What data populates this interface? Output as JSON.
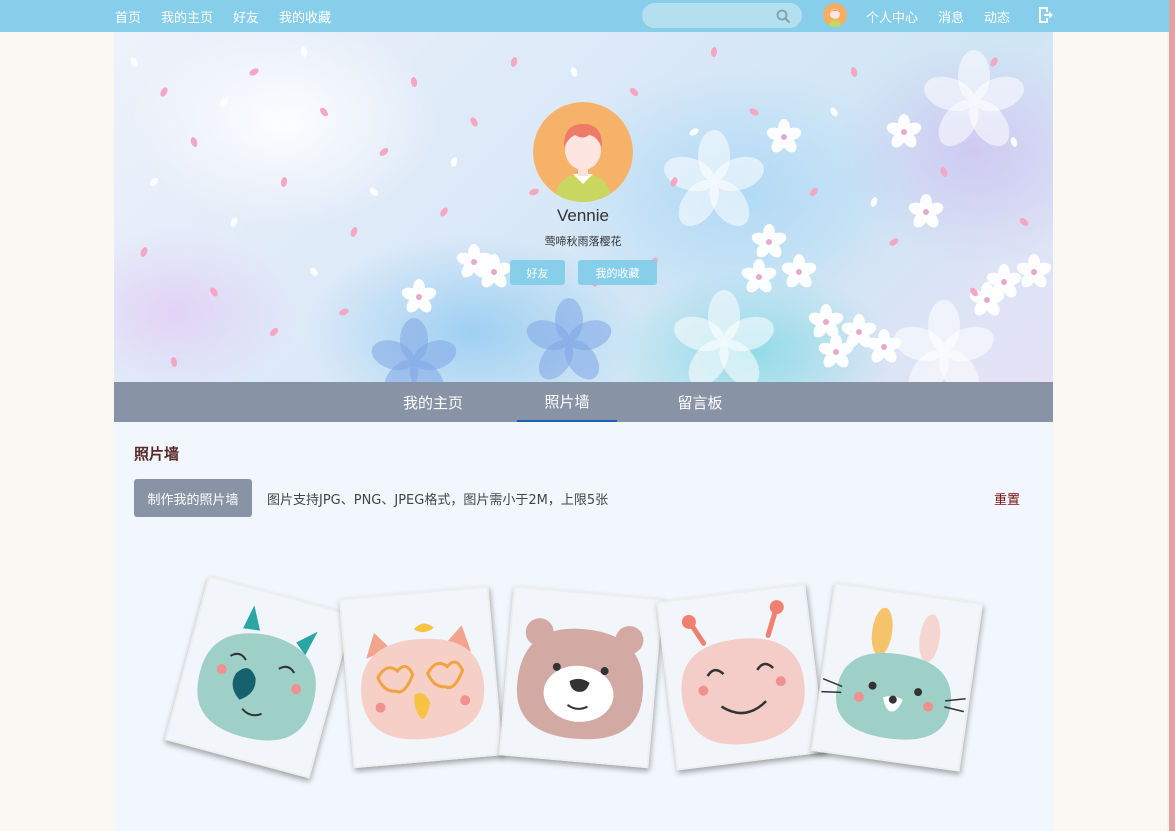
{
  "topnav": {
    "links": [
      "首页",
      "我的主页",
      "好友",
      "我的收藏"
    ],
    "search_placeholder": "",
    "right_links": [
      "个人中心",
      "消息",
      "动态"
    ]
  },
  "profile": {
    "name": "Vennie",
    "bio": "莺啼秋雨落樱花",
    "friends_button": "好友",
    "favorites_button": "我的收藏"
  },
  "tabs": [
    "我的主页",
    "照片墙",
    "留言板"
  ],
  "active_tab": "照片墙",
  "photo_wall": {
    "title": "照片墙",
    "make_button": "制作我的照片墙",
    "hint": "图片支持JPG、PNG、JPEG格式，图片需小于2M，上限5张",
    "reset_link": "重置",
    "photos": [
      {
        "name": "teal-monster"
      },
      {
        "name": "pink-cat-glasses"
      },
      {
        "name": "brown-bear"
      },
      {
        "name": "pink-monster"
      },
      {
        "name": "teal-bunny"
      }
    ]
  },
  "colors": {
    "nav_bg": "#87ceeb",
    "tab_bar": "#8894a6",
    "active_tab_underline": "#1a5fb4",
    "content_bg": "#f2f7fd",
    "reset_link": "#7a1010"
  }
}
